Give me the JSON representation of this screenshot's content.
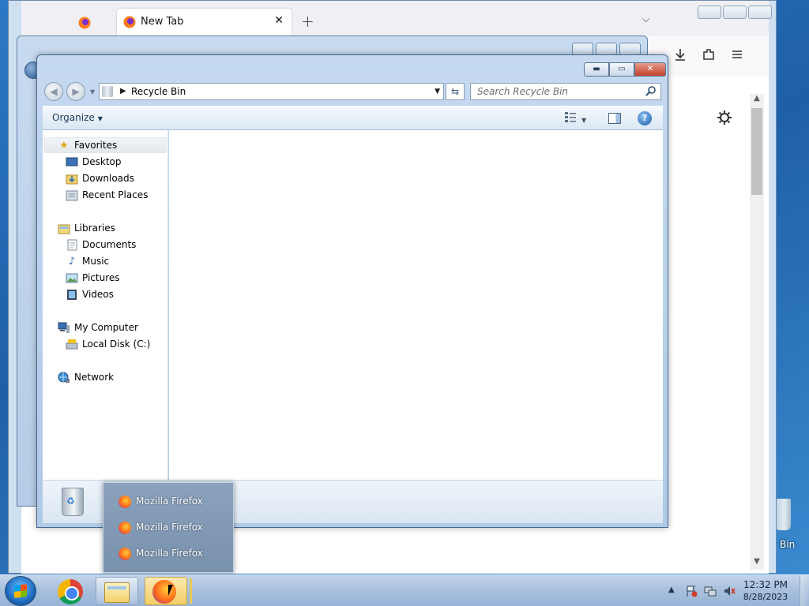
{
  "browser": {
    "tab_title": "New Tab",
    "tab_close": "✕",
    "new_tab": "+",
    "list_tabs": "⌵",
    "icons": [
      "download-icon",
      "extensions-icon",
      "menu-icon",
      "settings-gear-icon"
    ]
  },
  "explorer": {
    "address": "Recycle Bin",
    "search_placeholder": "Search Recycle Bin",
    "organize_label": "Organize",
    "window_buttons": {
      "minimize": "▬",
      "maximize": "▭",
      "close": "✕"
    },
    "nav": {
      "favorites": "Favorites",
      "desktop": "Desktop",
      "downloads": "Downloads",
      "recent_places": "Recent Places",
      "libraries": "Libraries",
      "documents": "Documents",
      "music": "Music",
      "pictures": "Pictures",
      "videos": "Videos",
      "my_computer": "My Computer",
      "local_disk": "Local Disk (C:)",
      "network": "Network"
    }
  },
  "popup": {
    "items": [
      "Mozilla Firefox",
      "Mozilla Firefox",
      "Mozilla Firefox"
    ]
  },
  "desktop": {
    "recycle_label": "Bin"
  },
  "taskbar": {
    "pinned": [
      "chrome",
      "windows-explorer",
      "firefox"
    ],
    "time": "12:32 PM",
    "date": "8/28/2023"
  },
  "colors": {
    "taskbar": "#a9c1de",
    "window_frame": "#b0c9e6",
    "popup": "#8ba2bc"
  }
}
